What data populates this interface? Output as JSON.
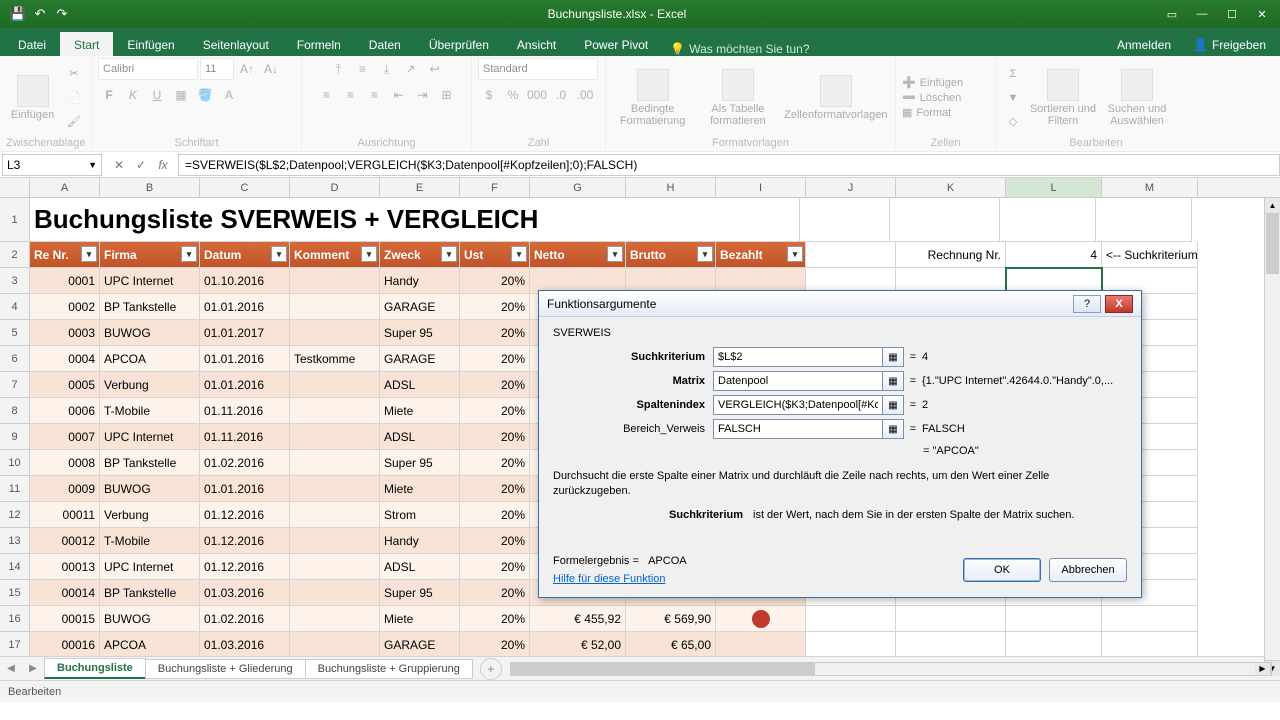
{
  "titlebar": {
    "title": "Buchungsliste.xlsx - Excel"
  },
  "ribbon": {
    "tabs": {
      "file": "Datei",
      "start": "Start",
      "einfuegen": "Einfügen",
      "seitenlayout": "Seitenlayout",
      "formeln": "Formeln",
      "daten": "Daten",
      "ueberpruefen": "Überprüfen",
      "ansicht": "Ansicht",
      "powerpivot": "Power Pivot"
    },
    "tellme": "Was möchten Sie tun?",
    "anmelden": "Anmelden",
    "freigeben": "Freigeben",
    "groups": {
      "zwischenablage": {
        "label": "Zwischenablage",
        "einfuegen": "Einfügen"
      },
      "schriftart": {
        "label": "Schriftart",
        "font": "Calibri",
        "size": "11"
      },
      "ausrichtung": {
        "label": "Ausrichtung"
      },
      "zahl": {
        "label": "Zahl",
        "format": "Standard"
      },
      "formatvorlagen": {
        "label": "Formatvorlagen",
        "bedingte": "Bedingte Formatierung",
        "alstabelle": "Als Tabelle formatieren",
        "zellenformat": "Zellenformatvorlagen"
      },
      "zellen": {
        "label": "Zellen",
        "einfuegen": "Einfügen",
        "loeschen": "Löschen",
        "format": "Format"
      },
      "bearbeiten": {
        "label": "Bearbeiten",
        "sortieren": "Sortieren und Filtern",
        "suchen": "Suchen und Auswählen"
      }
    }
  },
  "namebox": "L3",
  "formula": "=SVERWEIS($L$2;Datenpool;VERGLEICH($K3;Datenpool[#Kopfzeilen];0);FALSCH)",
  "columns": [
    "A",
    "B",
    "C",
    "D",
    "E",
    "F",
    "G",
    "H",
    "I",
    "J",
    "K",
    "L",
    "M"
  ],
  "sheet_title": "Buchungsliste SVERWEIS + VERGLEICH",
  "headers": {
    "reNr": "Re Nr.",
    "firma": "Firma",
    "datum": "Datum",
    "kommentar": "Komment",
    "zweck": "Zweck",
    "ust": "Ust",
    "netto": "Netto",
    "brutto": "Brutto",
    "bezahlt": "Bezahlt"
  },
  "side": {
    "label": "Rechnung Nr.",
    "value": "4",
    "suchkrit": "<-- Suchkriterium"
  },
  "rows": [
    {
      "nr": "0001",
      "firma": "UPC Internet",
      "datum": "01.10.2016",
      "komm": "",
      "zweck": "Handy",
      "ust": "20%"
    },
    {
      "nr": "0002",
      "firma": "BP Tankstelle",
      "datum": "01.01.2016",
      "komm": "",
      "zweck": "GARAGE",
      "ust": "20%"
    },
    {
      "nr": "0003",
      "firma": "BUWOG",
      "datum": "01.01.2017",
      "komm": "",
      "zweck": "Super 95",
      "ust": "20%"
    },
    {
      "nr": "0004",
      "firma": "APCOA",
      "datum": "01.01.2016",
      "komm": "Testkomme",
      "zweck": "GARAGE",
      "ust": "20%"
    },
    {
      "nr": "0005",
      "firma": "Verbung",
      "datum": "01.01.2016",
      "komm": "",
      "zweck": "ADSL",
      "ust": "20%"
    },
    {
      "nr": "0006",
      "firma": "T-Mobile",
      "datum": "01.11.2016",
      "komm": "",
      "zweck": "Miete",
      "ust": "20%"
    },
    {
      "nr": "0007",
      "firma": "UPC Internet",
      "datum": "01.11.2016",
      "komm": "",
      "zweck": "ADSL",
      "ust": "20%"
    },
    {
      "nr": "0008",
      "firma": "BP Tankstelle",
      "datum": "01.02.2016",
      "komm": "",
      "zweck": "Super 95",
      "ust": "20%"
    },
    {
      "nr": "0009",
      "firma": "BUWOG",
      "datum": "01.01.2016",
      "komm": "",
      "zweck": "Miete",
      "ust": "20%"
    },
    {
      "nr": "00011",
      "firma": "Verbung",
      "datum": "01.12.2016",
      "komm": "",
      "zweck": "Strom",
      "ust": "20%"
    },
    {
      "nr": "00012",
      "firma": "T-Mobile",
      "datum": "01.12.2016",
      "komm": "",
      "zweck": "Handy",
      "ust": "20%"
    },
    {
      "nr": "00013",
      "firma": "UPC Internet",
      "datum": "01.12.2016",
      "komm": "",
      "zweck": "ADSL",
      "ust": "20%"
    },
    {
      "nr": "00014",
      "firma": "BP Tankstelle",
      "datum": "01.03.2016",
      "komm": "",
      "zweck": "Super 95",
      "ust": "20%"
    },
    {
      "nr": "00015",
      "firma": "BUWOG",
      "datum": "01.02.2016",
      "komm": "",
      "zweck": "Miete",
      "ust": "20%",
      "netto": "€    455,92",
      "brutto": "€  569,90",
      "paid": true
    },
    {
      "nr": "00016",
      "firma": "APCOA",
      "datum": "01.03.2016",
      "komm": "",
      "zweck": "GARAGE",
      "ust": "20%",
      "netto": "€      52,00",
      "brutto": "€    65,00"
    }
  ],
  "sheets": {
    "s1": "Buchungsliste",
    "s2": "Buchungsliste + Gliederung",
    "s3": "Buchungsliste + Gruppierung"
  },
  "status": "Bearbeiten",
  "dialog": {
    "title": "Funktionsargumente",
    "fn": "SVERWEIS",
    "args": {
      "suchkriterium": {
        "label": "Suchkriterium",
        "value": "$L$2",
        "result": "4"
      },
      "matrix": {
        "label": "Matrix",
        "value": "Datenpool",
        "result": "{1.\"UPC Internet\".42644.0.\"Handy\".0,..."
      },
      "spaltenindex": {
        "label": "Spaltenindex",
        "value": "VERGLEICH($K3;Datenpool[#Ko",
        "result": "2"
      },
      "bereich": {
        "label": "Bereich_Verweis",
        "value": "FALSCH",
        "result": "FALSCH"
      }
    },
    "fn_result_eq": "=  \"APCOA\"",
    "desc": "Durchsucht die erste Spalte einer Matrix und durchläuft die Zeile nach rechts, um den Wert einer Zelle zurückzugeben.",
    "argdesc_key": "Suchkriterium",
    "argdesc_val": "ist der Wert, nach dem Sie in der ersten Spalte der Matrix suchen.",
    "formelergebnis_label": "Formelergebnis =",
    "formelergebnis": "APCOA",
    "help": "Hilfe für diese Funktion",
    "ok": "OK",
    "cancel": "Abbrechen"
  }
}
